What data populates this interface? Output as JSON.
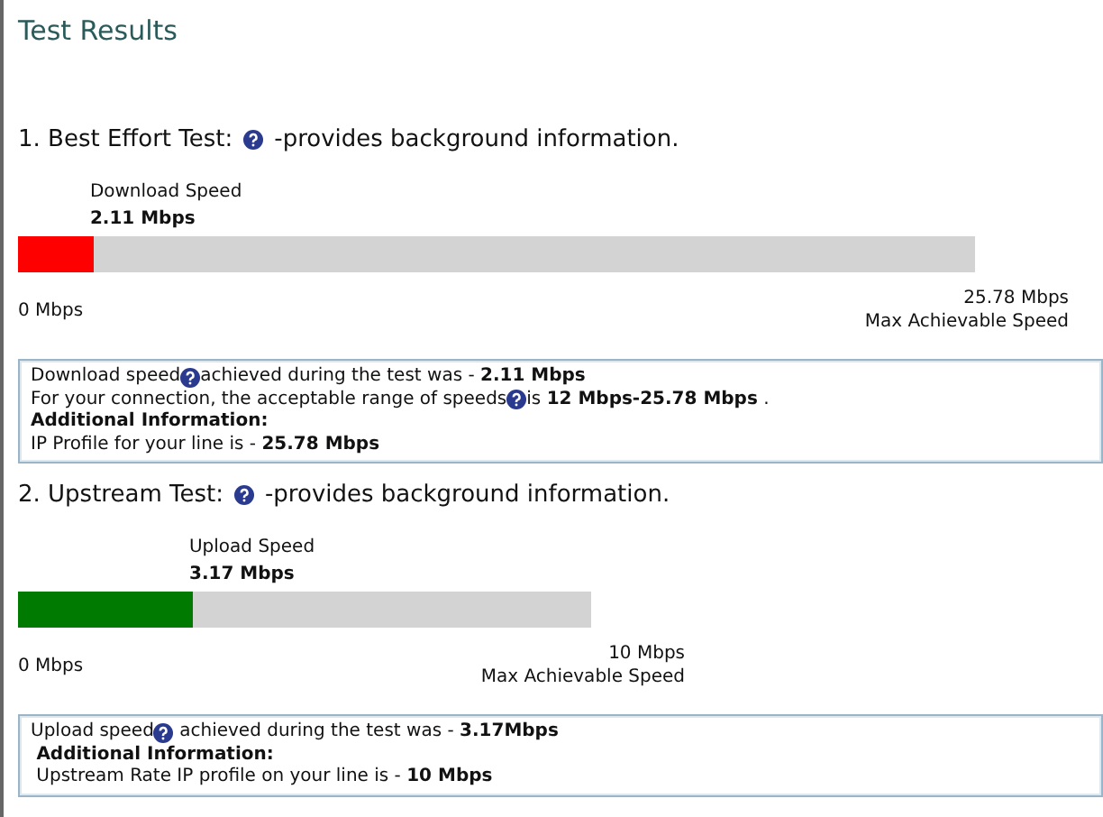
{
  "title": "Test Results",
  "tests": [
    {
      "heading_before": "1. Best Effort Test:",
      "heading_after": "-provides background information.",
      "speed_label": "Download Speed",
      "speed_value": "2.11 Mbps",
      "level": 0.079,
      "color": "#ff0000",
      "min_label": "0 Mbps",
      "max_value": "25.78 Mbps",
      "max_label": "Max Achievable Speed",
      "info": [
        [
          {
            "kind": "text",
            "text": "Download speed"
          },
          {
            "kind": "help"
          },
          {
            "kind": "text",
            "text": "achieved during the test was - **2.11 Mbps**"
          }
        ],
        [
          {
            "kind": "text",
            "text": "For your connection, the acceptable range of speeds"
          },
          {
            "kind": "help"
          },
          {
            "kind": "text",
            "text": "is **12 Mbps-25.78 Mbps** ."
          }
        ],
        [
          {
            "kind": "text",
            "text": "**Additional Information:**"
          }
        ],
        [
          {
            "kind": "text",
            "text": "IP Profile for your line is - **25.78 Mbps**"
          }
        ]
      ]
    },
    {
      "heading_before": "2. Upstream Test:",
      "heading_after": "-provides background information.",
      "speed_label": "Upload Speed",
      "speed_value": "3.17 Mbps",
      "level": 0.305,
      "color": "#007a00",
      "min_label": "0 Mbps",
      "max_value": "10 Mbps",
      "max_label": "Max Achievable Speed",
      "info": [
        [
          {
            "kind": "text",
            "text": "Upload speed"
          },
          {
            "kind": "help"
          },
          {
            "kind": "text",
            "text": " achieved during the test was - **3.17Mbps**"
          }
        ],
        [
          {
            "kind": "text",
            "text": " **Additional Information:**"
          }
        ],
        [
          {
            "kind": "text",
            "text": " Upstream Rate IP profile on your line is - **10 Mbps**"
          }
        ]
      ]
    }
  ]
}
